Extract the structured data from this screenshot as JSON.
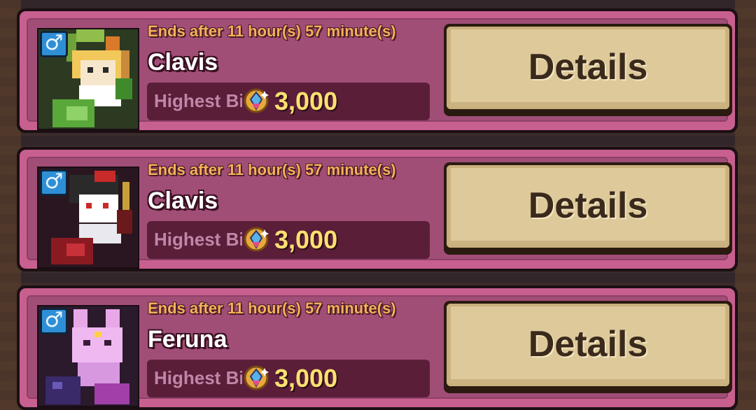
{
  "auctions": [
    {
      "ends": "Ends after 11 hour(s) 57 minute(s)",
      "name": "Clavis",
      "bid_label": "Highest Bi",
      "bid_value": "3,000",
      "details_label": "Details",
      "gender_symbol": "♂",
      "portrait_theme": "green"
    },
    {
      "ends": "Ends after 11 hour(s) 57 minute(s)",
      "name": "Clavis",
      "bid_label": "Highest Bi",
      "bid_value": "3,000",
      "details_label": "Details",
      "gender_symbol": "♂",
      "portrait_theme": "red"
    },
    {
      "ends": "Ends after 11 hour(s) 57 minute(s)",
      "name": "Feruna",
      "bid_label": "Highest Bi",
      "bid_value": "3,000",
      "details_label": "Details",
      "gender_symbol": "♂",
      "portrait_theme": "pink"
    }
  ],
  "colors": {
    "card_border": "#c8608f",
    "card_fill": "#a14e77",
    "ends_text": "#f4b15a",
    "bid_value": "#ffe070",
    "details_button": "#ddc99a",
    "gender_badge": "#2f8fd6"
  }
}
